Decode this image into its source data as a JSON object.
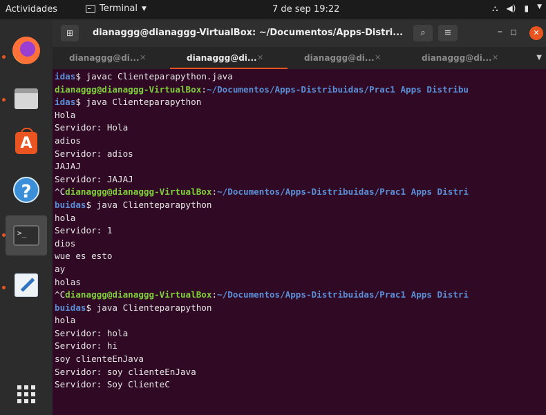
{
  "topbar": {
    "activities": "Actividades",
    "app_label": "Terminal",
    "clock": "7 de sep  19:22"
  },
  "dock": {
    "items": [
      "firefox",
      "files",
      "software",
      "help",
      "terminal",
      "text-editor",
      "show-applications"
    ]
  },
  "window": {
    "title": "dianaggg@dianaggg-VirtualBox: ~/Documentos/Apps-Distri...",
    "tabs": [
      {
        "label": "dianaggg@di...",
        "active": false
      },
      {
        "label": "dianaggg@di...",
        "active": true
      },
      {
        "label": "dianaggg@di...",
        "active": false
      },
      {
        "label": "dianaggg@di...",
        "active": false
      }
    ]
  },
  "terminal": {
    "lines": [
      [
        {
          "c": "b",
          "t": "idas"
        },
        {
          "t": "$ javac Clienteparapython.java"
        }
      ],
      [
        {
          "c": "g",
          "t": "dianaggg@dianaggg-VirtualBox"
        },
        {
          "t": ":"
        },
        {
          "c": "b",
          "t": "~/Documentos/Apps-Distribuidas/Prac1 Apps Distribu"
        }
      ],
      [
        {
          "c": "b",
          "t": "idas"
        },
        {
          "t": "$ java Clienteparapython"
        }
      ],
      [
        {
          "t": "Hola"
        }
      ],
      [
        {
          "t": "Servidor: Hola"
        }
      ],
      [
        {
          "t": "adios"
        }
      ],
      [
        {
          "t": "Servidor: adios"
        }
      ],
      [
        {
          "t": "JAJAJ"
        }
      ],
      [
        {
          "t": "Servidor: JAJAJ"
        }
      ],
      [
        {
          "t": "^C"
        },
        {
          "c": "g",
          "t": "dianaggg@dianaggg-VirtualBox"
        },
        {
          "t": ":"
        },
        {
          "c": "b",
          "t": "~/Documentos/Apps-Distribuidas/Prac1 Apps Distri"
        }
      ],
      [
        {
          "c": "b",
          "t": "buidas"
        },
        {
          "t": "$ java Clienteparapython"
        }
      ],
      [
        {
          "t": "hola"
        }
      ],
      [
        {
          "t": "Servidor: 1"
        }
      ],
      [
        {
          "t": "dios"
        }
      ],
      [
        {
          "t": "wue es esto"
        }
      ],
      [
        {
          "t": "ay"
        }
      ],
      [
        {
          "t": "holas"
        }
      ],
      [
        {
          "t": "^C"
        },
        {
          "c": "g",
          "t": "dianaggg@dianaggg-VirtualBox"
        },
        {
          "t": ":"
        },
        {
          "c": "b",
          "t": "~/Documentos/Apps-Distribuidas/Prac1 Apps Distri"
        }
      ],
      [
        {
          "c": "b",
          "t": "buidas"
        },
        {
          "t": "$ java Clienteparapython"
        }
      ],
      [
        {
          "t": "hola"
        }
      ],
      [
        {
          "t": "Servidor: hola"
        }
      ],
      [
        {
          "t": "Servidor: hi"
        }
      ],
      [
        {
          "t": "soy clienteEnJava"
        }
      ],
      [
        {
          "t": "Servidor: soy clienteEnJava"
        }
      ],
      [
        {
          "t": "Servidor: Soy ClienteC"
        }
      ]
    ]
  },
  "colors": {
    "terminal_bg": "#300a24",
    "prompt_user": "#7fcf3a",
    "prompt_path": "#5a8ed6",
    "accent": "#e95420"
  }
}
